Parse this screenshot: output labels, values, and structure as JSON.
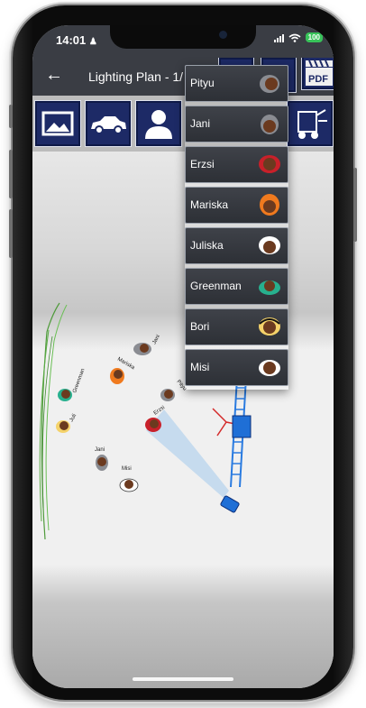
{
  "status_bar": {
    "time": "14:01",
    "battery": "100"
  },
  "app_bar": {
    "title": "Lighting Plan - 1/"
  },
  "toolbar": {
    "pdf_label": "PDF"
  },
  "menu": {
    "items": [
      {
        "label": "Pityu",
        "color": "#8a8c92"
      },
      {
        "label": "Jani",
        "color": "#8a8c92"
      },
      {
        "label": "Erzsi",
        "color": "#c8202a"
      },
      {
        "label": "Mariska",
        "color": "#f07a1e"
      },
      {
        "label": "Juliska",
        "color": "#ffffff"
      },
      {
        "label": "Greenman",
        "color": "#27b08e"
      },
      {
        "label": "Bori",
        "color": "#f4d26a"
      },
      {
        "label": "Misi",
        "color": "#ffffff"
      }
    ]
  },
  "plan": {
    "people": [
      {
        "label": "Jani"
      },
      {
        "label": "Mariska"
      },
      {
        "label": "Pityu"
      },
      {
        "label": "Erzsi"
      },
      {
        "label": "Greenman"
      },
      {
        "label": "Juli"
      },
      {
        "label": "Jani"
      },
      {
        "label": "Misi"
      }
    ]
  }
}
